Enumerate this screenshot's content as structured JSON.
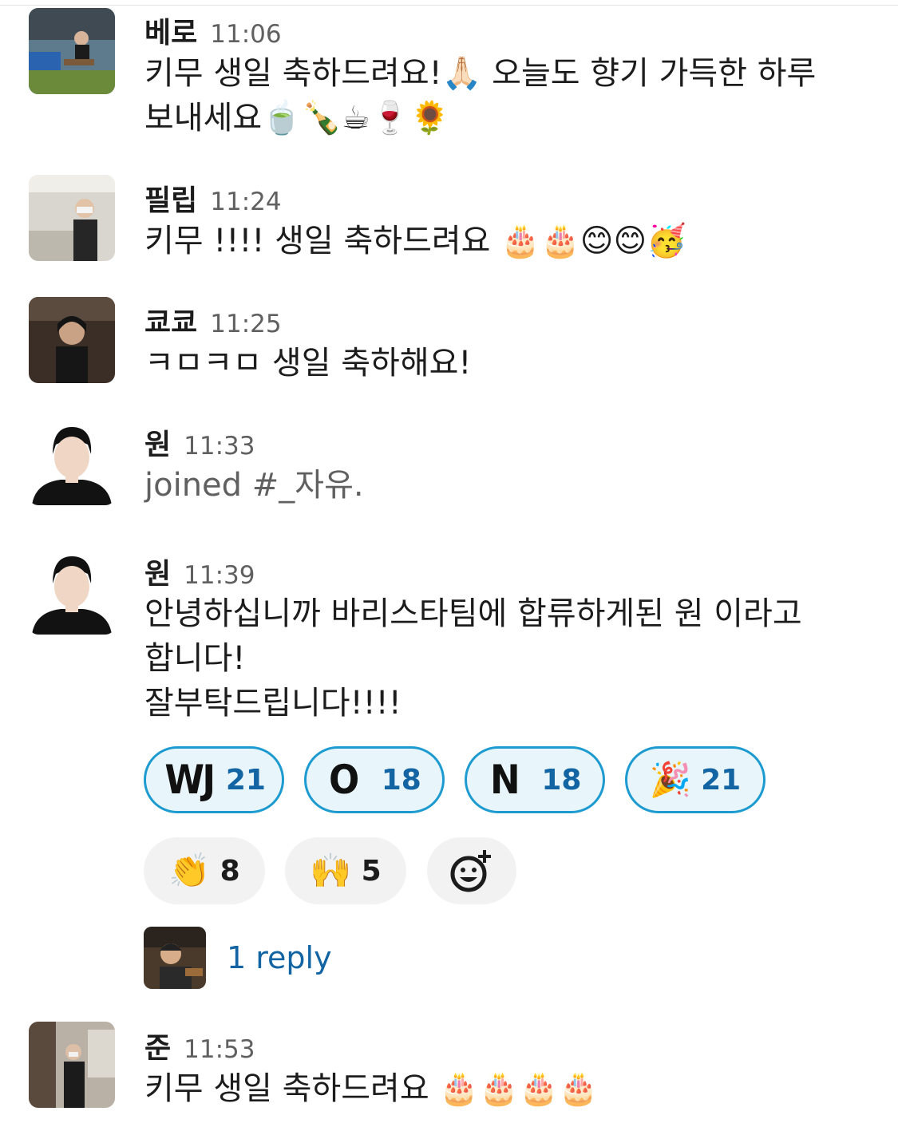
{
  "messages": [
    {
      "user": "베로",
      "time": "11:06",
      "lines": [
        "키무 생일 축하드려요!🙏🏻 오늘도 향기 가득한 하루",
        "보내세요🍵🍾☕🍷🌻"
      ],
      "avatar_icon": "person-photo-outdoor"
    },
    {
      "user": "필립",
      "time": "11:24",
      "lines": [
        "키무 !!!! 생일 축하드려요 🎂🎂😊😊🥳"
      ],
      "avatar_icon": "person-photo-masked"
    },
    {
      "user": "쿄쿄",
      "time": "11:25",
      "lines": [
        "ㅋㅁㅋㅁ 생일 축하해요!"
      ],
      "avatar_icon": "person-photo-dark"
    },
    {
      "user": "원",
      "time": "11:33",
      "lines": [
        "joined #_자유."
      ],
      "avatar_icon": "person-portrait"
    },
    {
      "user": "원",
      "time": "11:39",
      "lines": [
        "안녕하십니까 바리스타팀에 합류하게된 원 이라고",
        "합니다!",
        "잘부탁드립니다!!!!"
      ],
      "avatar_icon": "person-portrait"
    },
    {
      "user": "준",
      "time": "11:53",
      "lines": [
        "키무 생일 축하드려요 🎂🎂🎂🎂"
      ],
      "avatar_icon": "person-photo-store"
    }
  ],
  "reactions": [
    {
      "icon": "custom-wj-emoji",
      "glyph": "WJ",
      "count": "21",
      "active": true
    },
    {
      "icon": "custom-o-emoji",
      "glyph": "O",
      "count": "18",
      "active": true
    },
    {
      "icon": "custom-n-emoji",
      "glyph": "N",
      "count": "18",
      "active": true
    },
    {
      "icon": "party-popper-icon",
      "glyph": "🎉",
      "count": "21",
      "active": true
    },
    {
      "icon": "clapping-hands-icon",
      "glyph": "👏",
      "count": "8",
      "active": false
    },
    {
      "icon": "homer-cheering-icon",
      "glyph": "🙌",
      "count": "5",
      "active": false
    }
  ],
  "add_reaction_icon": "add-reaction-icon",
  "thread": {
    "reply_label": "1 reply"
  },
  "colors": {
    "link": "#1264a3",
    "reaction_border": "#1d9bd1",
    "reaction_bg": "#e8f5fa"
  }
}
